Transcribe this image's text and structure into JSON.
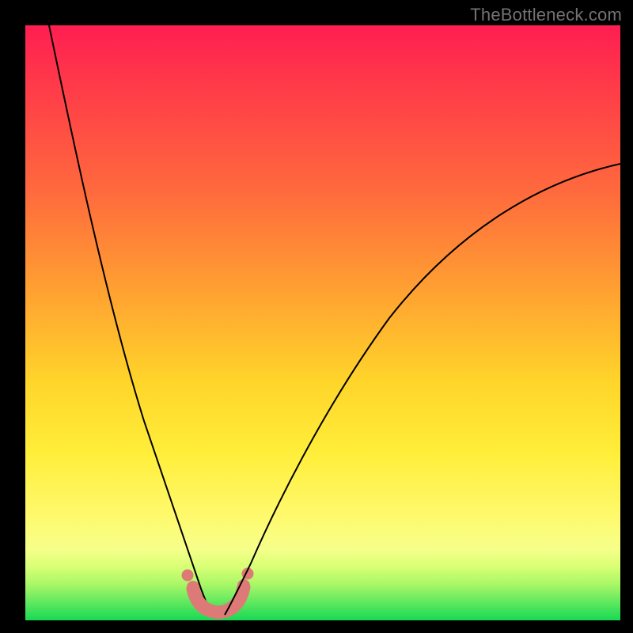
{
  "watermark": "TheBottleneck.com",
  "chart_data": {
    "type": "line",
    "title": "",
    "xlabel": "",
    "ylabel": "",
    "xlim": [
      0,
      100
    ],
    "ylim": [
      0,
      100
    ],
    "grid": false,
    "series": [
      {
        "name": "curve-left",
        "x": [
          4,
          6,
          8,
          10,
          12,
          14,
          16,
          18,
          20,
          22,
          24,
          26,
          28,
          29,
          30
        ],
        "values": [
          100,
          92,
          84,
          76,
          68,
          60,
          52,
          43,
          34,
          25,
          16,
          9,
          4,
          2,
          1
        ]
      },
      {
        "name": "curve-right",
        "x": [
          34,
          35,
          36,
          38,
          40,
          44,
          48,
          52,
          56,
          60,
          65,
          70,
          75,
          80,
          85,
          90,
          95,
          100
        ],
        "values": [
          1,
          2,
          4,
          8,
          13,
          22,
          30,
          37,
          43,
          48,
          54,
          59,
          63,
          67,
          70,
          73,
          75,
          77
        ]
      },
      {
        "name": "bottom-arc-thick",
        "color": "#dd7a77",
        "x": [
          26.5,
          27,
          28,
          29,
          30,
          31,
          32,
          33,
          34,
          35,
          36,
          37,
          37.5
        ],
        "values": [
          6.5,
          5,
          3,
          1.8,
          1.2,
          1,
          1,
          1,
          1.2,
          1.8,
          3,
          5,
          6.5
        ]
      },
      {
        "name": "bottom-band-green",
        "color": "#18d954",
        "x": [
          0,
          100
        ],
        "values": [
          0,
          0
        ]
      }
    ],
    "annotations": [
      {
        "text": "TheBottleneck.com",
        "pos": "top-right"
      }
    ]
  }
}
